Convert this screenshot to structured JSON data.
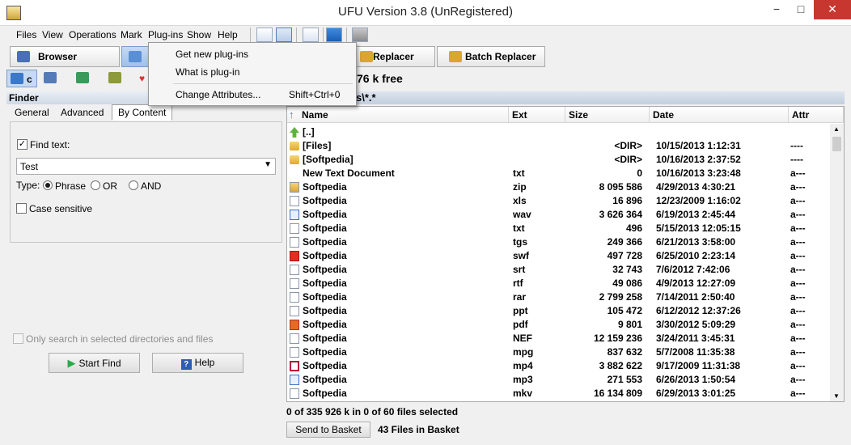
{
  "window": {
    "title": "UFU Version 3.8 (UnRegistered)",
    "min": "−",
    "max": "□",
    "close": "✕"
  },
  "menu": [
    "Files",
    "View",
    "Operations",
    "Mark",
    "Plug-ins",
    "Show",
    "Help"
  ],
  "modes": {
    "browser": "Browser",
    "replacer": "Replacer",
    "batch_replacer": "Batch Replacer"
  },
  "drives": {
    "c": "c",
    "d": "d",
    "net": "\\",
    "star": "*"
  },
  "free_space": "76 k free",
  "finder": {
    "title": "Finder",
    "tabs": [
      "General",
      "Advanced",
      "By Content"
    ],
    "find_text_label": "Find text:",
    "find_text_value": "Test",
    "type_label": "Type:",
    "types": [
      "Phrase",
      "OR",
      "AND"
    ],
    "case_sensitive": "Case sensitive",
    "only_selected": "Only search in selected directories and files",
    "start_find": "Start Find",
    "help": "Help"
  },
  "path": "s\\*.*",
  "columns": {
    "name": "Name",
    "ext": "Ext",
    "size": "Size",
    "date": "Date",
    "attr": "Attr"
  },
  "files": [
    {
      "icon": "up",
      "name": "[..]",
      "ext": "",
      "size": "",
      "date": "",
      "attr": ""
    },
    {
      "icon": "folder",
      "name": "[Files]",
      "ext": "",
      "size": "<DIR>",
      "date": "10/15/2013 1:12:31",
      "attr": "----"
    },
    {
      "icon": "folder",
      "name": "[Softpedia]",
      "ext": "",
      "size": "<DIR>",
      "date": "10/16/2013 2:37:52",
      "attr": "----"
    },
    {
      "icon": "none",
      "name": "New Text Document",
      "ext": "txt",
      "size": "0",
      "date": "10/16/2013 3:23:48",
      "attr": "a---"
    },
    {
      "icon": "zip",
      "name": "Softpedia",
      "ext": "zip",
      "size": "8 095 586",
      "date": "4/29/2013 4:30:21",
      "attr": "a---"
    },
    {
      "icon": "doc",
      "name": "Softpedia",
      "ext": "xls",
      "size": "16 896",
      "date": "12/23/2009 1:16:02",
      "attr": "a---"
    },
    {
      "icon": "audio",
      "name": "Softpedia",
      "ext": "wav",
      "size": "3 626 364",
      "date": "6/19/2013 2:45:44",
      "attr": "a---"
    },
    {
      "icon": "doc",
      "name": "Softpedia",
      "ext": "txt",
      "size": "496",
      "date": "5/15/2013 12:05:15",
      "attr": "a---"
    },
    {
      "icon": "doc",
      "name": "Softpedia",
      "ext": "tgs",
      "size": "249 366",
      "date": "6/21/2013 3:58:00",
      "attr": "a---"
    },
    {
      "icon": "swf",
      "name": "Softpedia",
      "ext": "swf",
      "size": "497 728",
      "date": "6/25/2010 2:23:14",
      "attr": "a---"
    },
    {
      "icon": "doc",
      "name": "Softpedia",
      "ext": "srt",
      "size": "32 743",
      "date": "7/6/2012 7:42:06",
      "attr": "a---"
    },
    {
      "icon": "doc",
      "name": "Softpedia",
      "ext": "rtf",
      "size": "49 086",
      "date": "4/9/2013 12:27:09",
      "attr": "a---"
    },
    {
      "icon": "doc",
      "name": "Softpedia",
      "ext": "rar",
      "size": "2 799 258",
      "date": "7/14/2011 2:50:40",
      "attr": "a---"
    },
    {
      "icon": "doc",
      "name": "Softpedia",
      "ext": "ppt",
      "size": "105 472",
      "date": "6/12/2012 12:37:26",
      "attr": "a---"
    },
    {
      "icon": "pdf",
      "name": "Softpedia",
      "ext": "pdf",
      "size": "9 801",
      "date": "3/30/2012 5:09:29",
      "attr": "a---"
    },
    {
      "icon": "doc",
      "name": "Softpedia",
      "ext": "NEF",
      "size": "12 159 236",
      "date": "3/24/2011 3:45:31",
      "attr": "a---"
    },
    {
      "icon": "doc",
      "name": "Softpedia",
      "ext": "mpg",
      "size": "837 632",
      "date": "5/7/2008 11:35:38",
      "attr": "a---"
    },
    {
      "icon": "video",
      "name": "Softpedia",
      "ext": "mp4",
      "size": "3 882 622",
      "date": "9/17/2009 11:31:38",
      "attr": "a---"
    },
    {
      "icon": "audio",
      "name": "Softpedia",
      "ext": "mp3",
      "size": "271 553",
      "date": "6/26/2013 1:50:54",
      "attr": "a---"
    },
    {
      "icon": "doc",
      "name": "Softpedia",
      "ext": "mkv",
      "size": "16 134 809",
      "date": "6/29/2013 3:01:25",
      "attr": "a---"
    }
  ],
  "status": "0 of 335 926 k in 0 of 60 files selected",
  "basket": {
    "button": "Send to Basket",
    "text": "43 Files in Basket"
  },
  "plugins_menu": {
    "items": [
      "Get new plug-ins",
      "What is plug-in",
      "Change Attributes..."
    ],
    "shortcut": "Shift+Ctrl+0"
  },
  "colors": {
    "accent": "#d9e4f2",
    "close": "#c7372f",
    "header": "#cfd9e6"
  }
}
